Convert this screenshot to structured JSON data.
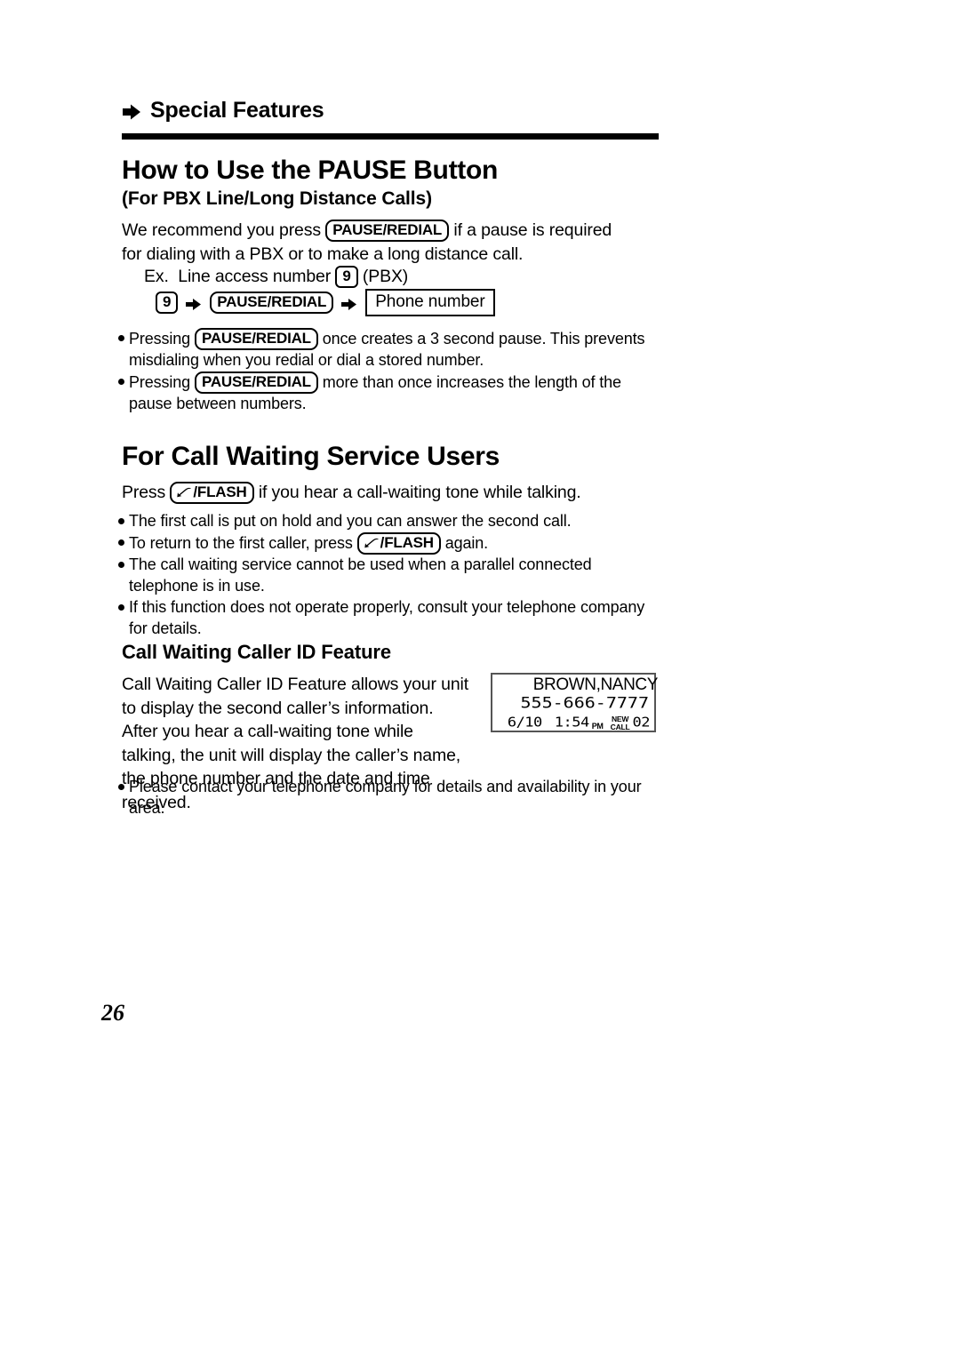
{
  "section": {
    "bullet_icon": "right-arrow-icon",
    "title": "Special Features"
  },
  "pause_section": {
    "heading": "How to Use the PAUSE Button",
    "subheading": "(For PBX Line/Long Distance Calls)",
    "intro_before": "We recommend you press ",
    "intro_key": "PAUSE/REDIAL",
    "intro_after": " if a pause is required for dialing with a PBX or to make a long distance call.",
    "example_label": "Ex.",
    "example_text_before": "Line access number ",
    "example_key_9": "9",
    "example_text_after": " (PBX)",
    "sequence": {
      "key_9": "9",
      "key_pause": "PAUSE/REDIAL",
      "box_phone": "Phone number",
      "arrow_icon": "right-arrow-icon"
    },
    "notes": [
      {
        "before": "Pressing ",
        "key": "PAUSE/REDIAL",
        "after": " once creates a 3 second pause. This prevents misdialing when you redial or dial a stored number."
      },
      {
        "before": "Pressing ",
        "key": "PAUSE/REDIAL",
        "after": " more than once increases the length of the pause between numbers."
      }
    ]
  },
  "call_waiting_section": {
    "heading": "For Call Waiting Service Users",
    "intro_before": "Press ",
    "intro_key": "/FLASH",
    "intro_key_icon": "hook-flash-icon",
    "intro_after": " if you hear a call-waiting tone while talking.",
    "notes": [
      {
        "before": "The first call is put on hold and you can answer the second call.",
        "key": "",
        "after": ""
      },
      {
        "before": "To return to the first caller, press ",
        "key": "/FLASH",
        "after": " again."
      },
      {
        "before": "The call waiting service cannot be used when a parallel connected telephone is in use.",
        "key": "",
        "after": ""
      },
      {
        "before": "If this function does not operate properly, consult your telephone company for details.",
        "key": "",
        "after": ""
      }
    ]
  },
  "caller_id_section": {
    "heading": "Call Waiting Caller ID Feature",
    "body": "Call Waiting Caller ID Feature allows your unit to display the second caller’s information. After you hear a call-waiting tone while talking, the unit will display the caller’s name, the phone number and the date and time received.",
    "lcd": {
      "name": "BROWN,NANCY",
      "number": "555-666-7777",
      "date": "6/10",
      "time": "1:54",
      "ampm": "PM",
      "new_call_line1": "NEW",
      "new_call_line2": "CALL",
      "call_count": "02"
    },
    "footnote": "Please contact your telephone company for details and availability in your area."
  },
  "footer": {
    "page_number": "26"
  }
}
